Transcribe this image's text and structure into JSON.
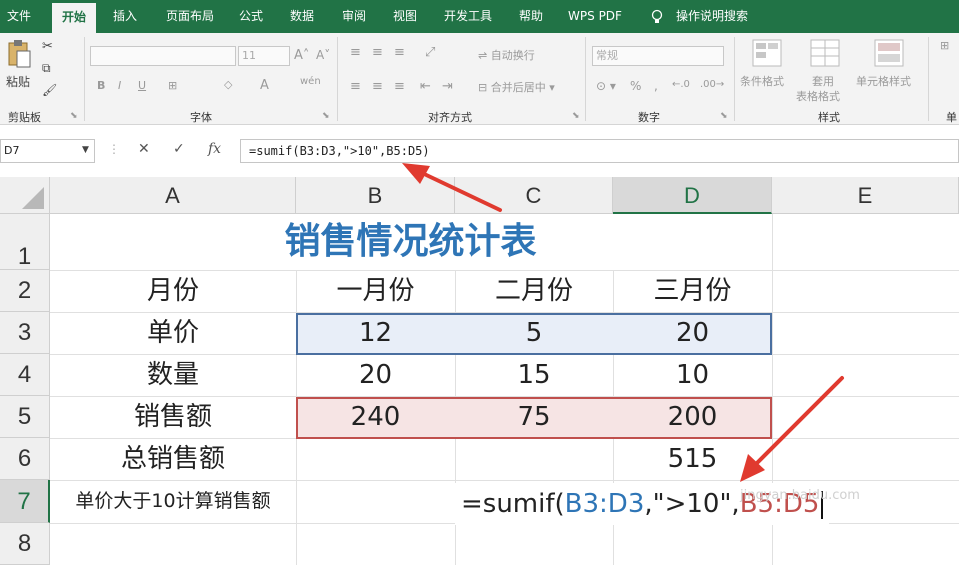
{
  "ribbon": {
    "tabs": [
      "文件",
      "开始",
      "插入",
      "页面布局",
      "公式",
      "数据",
      "审阅",
      "视图",
      "开发工具",
      "帮助",
      "WPS PDF",
      "操作说明搜索"
    ],
    "active_tab": "开始",
    "groups": {
      "clipboard": "剪贴板",
      "font": "字体",
      "alignment": "对齐方式",
      "number": "数字",
      "styles": "样式"
    },
    "paste_label": "粘贴",
    "font_size": "11",
    "wrap_text": "自动换行",
    "merge_center": "合并后居中",
    "number_format": "常规",
    "conditional_format": "条件格式",
    "format_table_1": "套用",
    "format_table_2": "表格格式",
    "cell_styles": "单元格样式",
    "cut_off_label": "单"
  },
  "formula_bar": {
    "name_box": "D7",
    "formula": "=sumif(B3:D3,\">10\",B5:D5)"
  },
  "columns": [
    "A",
    "B",
    "C",
    "D",
    "E"
  ],
  "rows": [
    "1",
    "2",
    "3",
    "4",
    "5",
    "6",
    "7",
    "8"
  ],
  "sheet": {
    "title": "销售情况统计表",
    "row2": [
      "月份",
      "一月份",
      "二月份",
      "三月份"
    ],
    "row3": [
      "单价",
      "12",
      "5",
      "20"
    ],
    "row4": [
      "数量",
      "20",
      "15",
      "10"
    ],
    "row5": [
      "销售额",
      "240",
      "75",
      "200"
    ],
    "row6": [
      "总销售额",
      "",
      "",
      "515"
    ],
    "row7_label": "单价大于10计算销售额",
    "row7_formula_parts": [
      "=sumif(",
      "B3:D3",
      ",\">10\",",
      "B5:D5"
    ]
  },
  "watermark": "jingyan.baidu.com",
  "colors": {
    "excel_green": "#217346",
    "title_blue": "#2e75b6",
    "arrow_red": "#e03a2f"
  }
}
